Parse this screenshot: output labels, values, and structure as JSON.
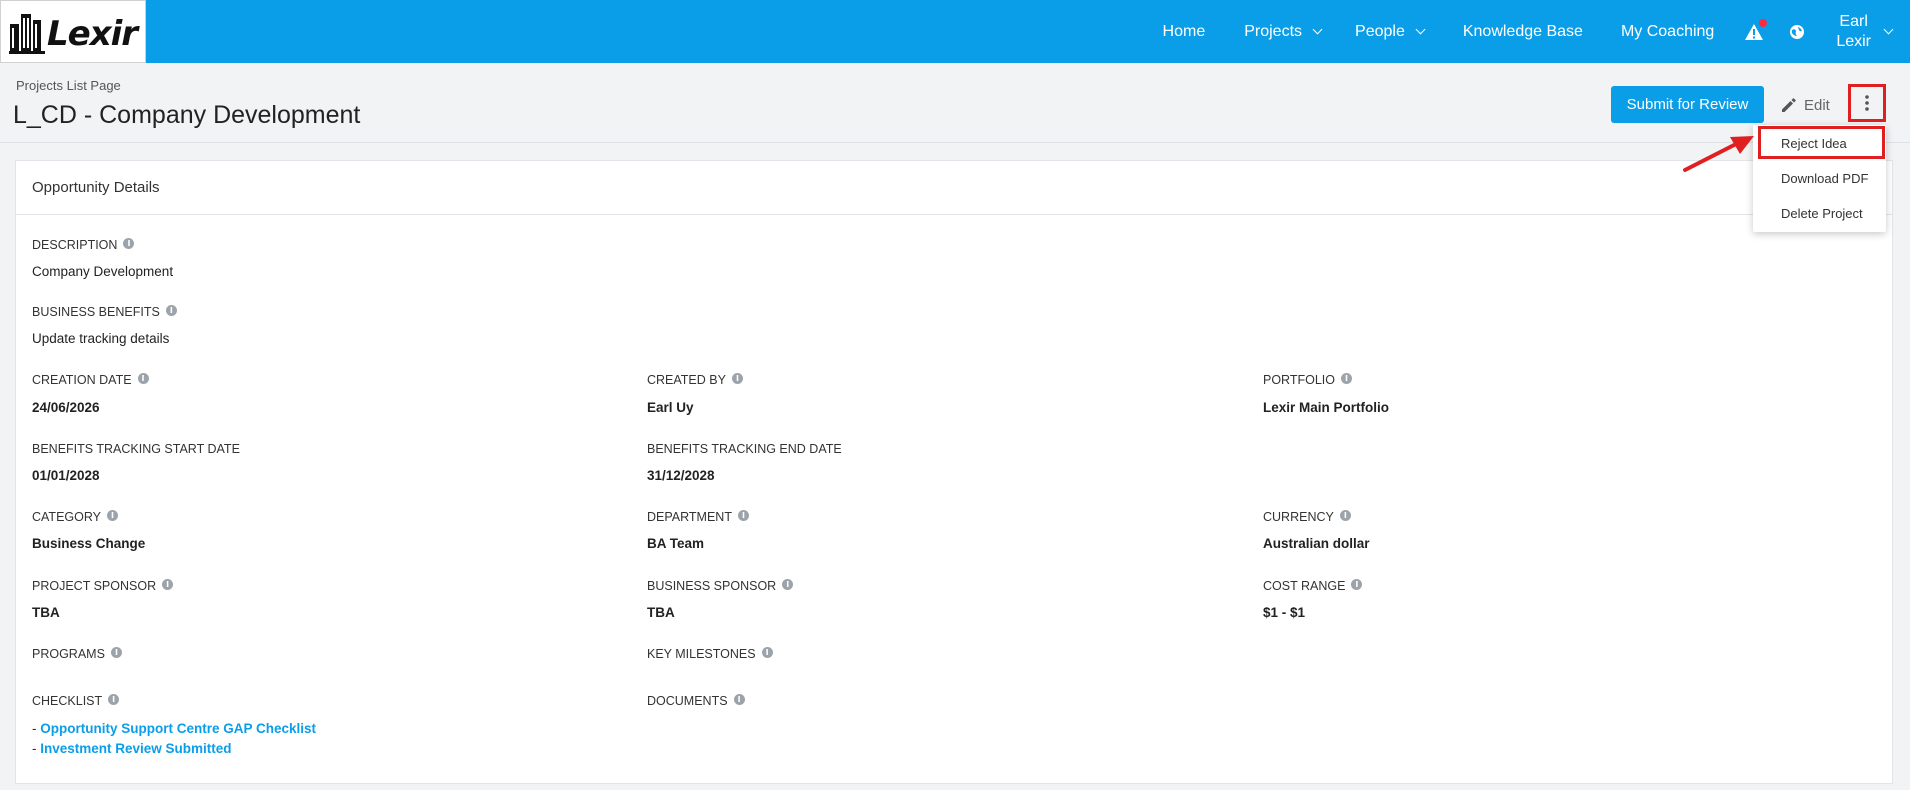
{
  "brand": {
    "logo_text": "Lexir"
  },
  "nav": {
    "home": "Home",
    "projects": "Projects",
    "people": "People",
    "knowledge_base": "Knowledge Base",
    "my_coaching": "My Coaching",
    "user_first": "Earl",
    "user_last": "Lexir"
  },
  "header": {
    "breadcrumb": "Projects List Page",
    "title": "L_CD - Company Development",
    "submit_label": "Submit for Review",
    "edit_label": "Edit"
  },
  "menu": {
    "items": [
      "Reject Idea",
      "Download PDF",
      "Delete Project"
    ]
  },
  "card": {
    "title": "Opportunity Details",
    "description_label": "DESCRIPTION",
    "description_value": "Company Development",
    "benefits_label": "BUSINESS BENEFITS",
    "benefits_value": "Update tracking details",
    "creation_date_label": "CREATION DATE",
    "creation_date_value": "24/06/2026",
    "created_by_label": "CREATED BY",
    "created_by_value": "Earl Uy",
    "portfolio_label": "PORTFOLIO",
    "portfolio_value": "Lexir Main Portfolio",
    "bt_start_label": "BENEFITS TRACKING START DATE",
    "bt_start_value": "01/01/2028",
    "bt_end_label": "BENEFITS TRACKING END DATE",
    "bt_end_value": "31/12/2028",
    "category_label": "CATEGORY",
    "category_value": "Business Change",
    "department_label": "DEPARTMENT",
    "department_value": "BA Team",
    "currency_label": "CURRENCY",
    "currency_value": "Australian dollar",
    "project_sponsor_label": "PROJECT SPONSOR",
    "project_sponsor_value": "TBA",
    "business_sponsor_label": "BUSINESS SPONSOR",
    "business_sponsor_value": "TBA",
    "cost_range_label": "COST RANGE",
    "cost_range_value": "$1 - $1",
    "programs_label": "PROGRAMS",
    "milestones_label": "KEY MILESTONES",
    "checklist_label": "CHECKLIST",
    "checklist_items": [
      "Opportunity Support Centre GAP Checklist",
      "Investment Review Submitted"
    ],
    "documents_label": "DOCUMENTS"
  },
  "colors": {
    "accent": "#0a9ee8",
    "highlight": "#e02020"
  },
  "icons": [
    "building-logo-icon",
    "chevron-down-icon",
    "alert-icon",
    "globe-icon",
    "pencil-icon",
    "kebab-menu-icon",
    "info-icon",
    "arrow-annotation-icon"
  ]
}
